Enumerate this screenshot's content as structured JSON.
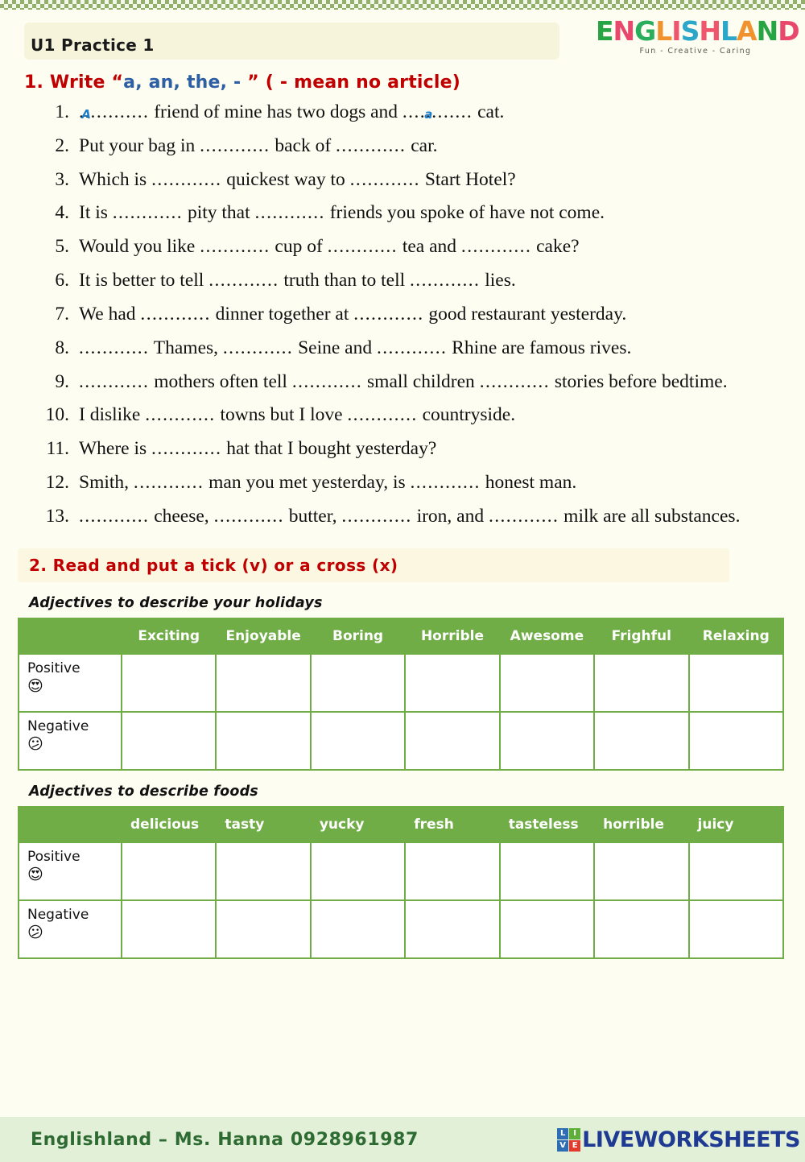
{
  "header": {
    "title": "U1 Practice 1",
    "logo": {
      "letters": [
        {
          "char": "E",
          "color": "#27A544"
        },
        {
          "char": "N",
          "color": "#E8486C"
        },
        {
          "char": "G",
          "color": "#2AAE5B"
        },
        {
          "char": "L",
          "color": "#F0932F"
        },
        {
          "char": "I",
          "color": "#F0556E"
        },
        {
          "char": "S",
          "color": "#2CA6C9"
        },
        {
          "char": "H",
          "color": "#F0556E"
        },
        {
          "char": "L",
          "color": "#2CA6C9"
        },
        {
          "char": "A",
          "color": "#F0932F"
        },
        {
          "char": "N",
          "color": "#27A544"
        },
        {
          "char": "D",
          "color": "#E8486C"
        }
      ],
      "tagline": "Fun - Creative - Caring"
    }
  },
  "section1": {
    "heading_part1": "1. Write “",
    "heading_highlight": "a, an, the, - ",
    "heading_part2": "” ( - mean no article)",
    "blank": "............",
    "items": [
      {
        "segments": [
          "",
          " friend of mine has two dogs and ",
          " cat."
        ],
        "answers": [
          "A",
          "a"
        ]
      },
      {
        "segments": [
          "Put your bag in ",
          " back of ",
          " car."
        ],
        "answers": []
      },
      {
        "segments": [
          "Which is ",
          " quickest way to ",
          " Start Hotel?"
        ],
        "answers": []
      },
      {
        "segments": [
          "It is ",
          " pity that ",
          " friends you spoke of have not come."
        ],
        "answers": []
      },
      {
        "segments": [
          "Would you like ",
          " cup of ",
          " tea and ",
          " cake?"
        ],
        "answers": []
      },
      {
        "segments": [
          "It is better to tell ",
          " truth than to tell ",
          " lies."
        ],
        "answers": []
      },
      {
        "segments": [
          "We had ",
          " dinner together at ",
          " good restaurant yesterday."
        ],
        "answers": []
      },
      {
        "segments": [
          "",
          " Thames, ",
          " Seine and ",
          " Rhine are famous rives."
        ],
        "answers": []
      },
      {
        "segments": [
          "",
          " mothers often tell ",
          " small children ",
          " stories before bedtime."
        ],
        "answers": []
      },
      {
        "segments": [
          "I dislike ",
          " towns but I love ",
          " countryside."
        ],
        "answers": []
      },
      {
        "segments": [
          "Where is ",
          " hat that I bought yesterday?"
        ],
        "answers": []
      },
      {
        "segments": [
          "Smith, ",
          " man you met yesterday, is ",
          " honest man."
        ],
        "answers": []
      },
      {
        "segments": [
          "",
          " cheese, ",
          " butter, ",
          " iron, and ",
          " milk are all substances."
        ],
        "answers": []
      }
    ]
  },
  "section2": {
    "heading": "2. Read and put a tick (v) or a cross (x)",
    "tables": [
      {
        "caption": "Adjectives to describe your holidays",
        "headers": [
          "",
          "Exciting",
          "Enjoyable",
          "Boring",
          "Horrible",
          "Awesome",
          "Frighful",
          "Relaxing"
        ],
        "rows": [
          {
            "label": "Positive",
            "emoji": "😍",
            "cells": [
              "",
              "",
              "",
              "",
              "",
              "",
              ""
            ]
          },
          {
            "label": "Negative",
            "emoji": "😕",
            "cells": [
              "",
              "",
              "",
              "",
              "",
              "",
              ""
            ]
          }
        ]
      },
      {
        "caption": "Adjectives to describe foods",
        "headers": [
          "",
          "delicious",
          "tasty",
          "yucky",
          "fresh",
          "tasteless",
          "horrible",
          "juicy"
        ],
        "rows": [
          {
            "label": "Positive",
            "emoji": "😍",
            "cells": [
              "",
              "",
              "",
              "",
              "",
              "",
              ""
            ]
          },
          {
            "label": "Negative",
            "emoji": "😕",
            "cells": [
              "",
              "",
              "",
              "",
              "",
              "",
              ""
            ]
          }
        ]
      }
    ]
  },
  "footer": {
    "text": "Englishland – Ms. Hanna 0928961987",
    "brand": "LIVEWORKSHEETS",
    "brand_icon": [
      {
        "char": "L",
        "bg": "#2E6DB4"
      },
      {
        "char": "I",
        "bg": "#5EAE3A"
      },
      {
        "char": "V",
        "bg": "#2E6DB4"
      },
      {
        "char": "E",
        "bg": "#E23B2E"
      }
    ]
  },
  "colors": {
    "page_bg": "#FEFDF2",
    "accent_red": "#C00000",
    "accent_blue": "#2E5FA3",
    "table_green": "#70AD47",
    "footer_green": "#E3F0D8",
    "answer_blue": "#1F7CC7"
  }
}
